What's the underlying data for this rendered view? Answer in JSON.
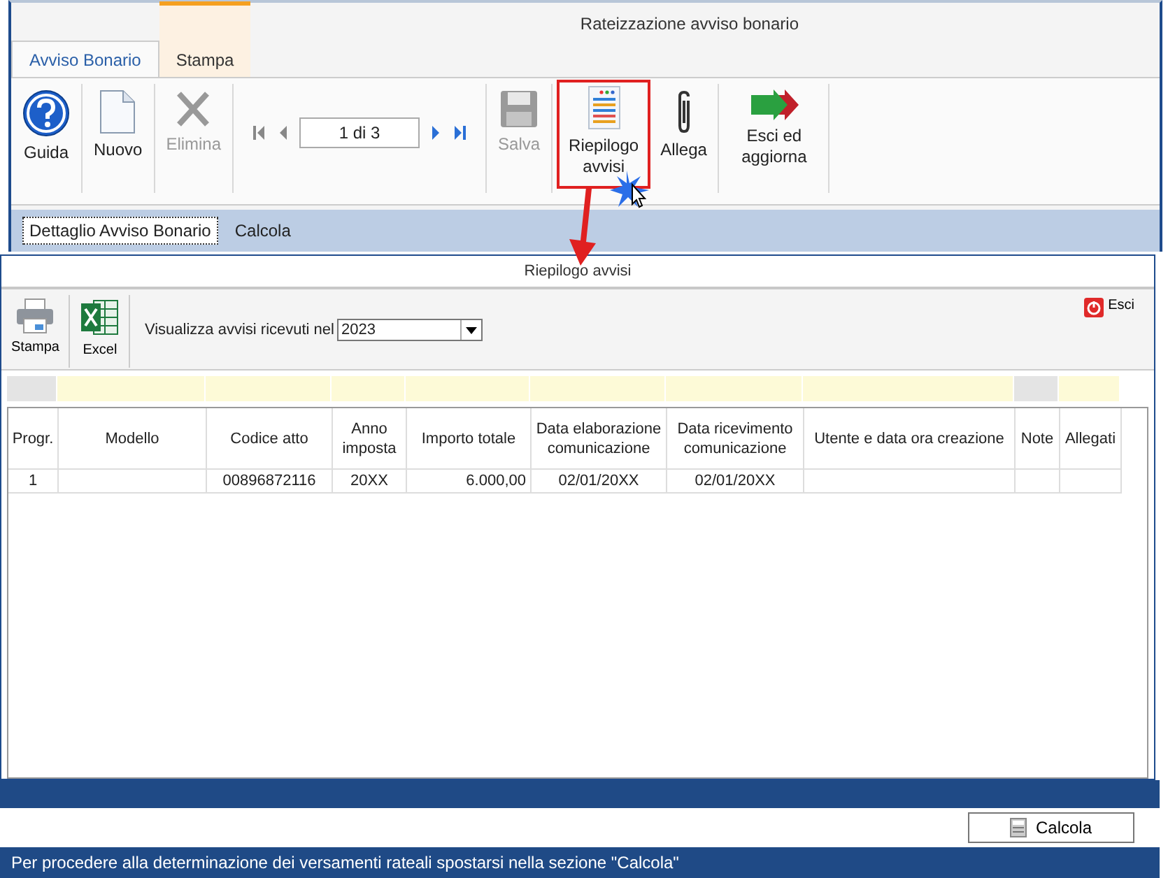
{
  "window": {
    "title": "Rateizzazione avviso bonario"
  },
  "tabs": [
    {
      "label": "Avviso Bonario",
      "selected": true,
      "contextual": false
    },
    {
      "label": "Stampa",
      "selected": false,
      "contextual": true
    }
  ],
  "ribbon": {
    "groups": [
      [
        {
          "kind": "help",
          "label": "Guida",
          "disabled": false,
          "highlighted": false
        }
      ],
      [
        {
          "kind": "new",
          "label": "Nuovo",
          "disabled": false,
          "highlighted": false
        }
      ],
      [
        {
          "kind": "delete",
          "label": "Elimina",
          "disabled": true,
          "highlighted": false
        }
      ],
      [
        {
          "kind": "pager",
          "value": "1 di 3"
        }
      ],
      [
        {
          "kind": "save",
          "label": "Salva",
          "disabled": true,
          "highlighted": false
        }
      ],
      [
        {
          "kind": "summary",
          "label": "Riepilogo avvisi",
          "disabled": false,
          "highlighted": true
        },
        {
          "kind": "attach",
          "label": "Allega",
          "disabled": false,
          "highlighted": false
        }
      ],
      [
        {
          "kind": "exit",
          "label": "Esci ed aggiorna",
          "disabled": false,
          "highlighted": false
        }
      ]
    ]
  },
  "subtabs": [
    {
      "label": "Dettaglio Avviso Bonario",
      "selected": true
    },
    {
      "label": "Calcola",
      "selected": false
    }
  ],
  "dialog": {
    "title": "Riepilogo avvisi",
    "toolbar": [
      {
        "kind": "print",
        "label": "Stampa"
      },
      {
        "kind": "excel",
        "label": "Excel"
      }
    ],
    "filter": {
      "label": "Visualizza avvisi ricevuti nel",
      "value": "2023"
    },
    "close": "Esci",
    "table": {
      "columns": [
        {
          "header": "Progr.",
          "filterable": false,
          "kind": "text"
        },
        {
          "header": "Modello",
          "filterable": true,
          "kind": "text"
        },
        {
          "header": "Codice atto",
          "filterable": true,
          "kind": "text"
        },
        {
          "header": "Anno imposta",
          "filterable": true,
          "kind": "text"
        },
        {
          "header": "Importo totale",
          "filterable": true,
          "kind": "amount"
        },
        {
          "header": "Data elaborazione comunicazione",
          "filterable": true,
          "kind": "text"
        },
        {
          "header": "Data ricevimento comunicazione",
          "filterable": true,
          "kind": "text"
        },
        {
          "header": "Utente e data ora creazione",
          "filterable": true,
          "kind": "text"
        },
        {
          "header": "Note",
          "filterable": false,
          "kind": "text"
        },
        {
          "header": "Allegati",
          "filterable": true,
          "kind": "text"
        }
      ],
      "rows": [
        [
          "1",
          "",
          "00896872116",
          "20XX",
          "6.000,00",
          "02/01/20XX",
          "02/01/20XX",
          "",
          "",
          ""
        ]
      ]
    }
  },
  "footer": {
    "button": "Calcola"
  },
  "status_bar": "Per procedere alla determinazione dei versamenti rateali spostarsi nella sezione \"Calcola\""
}
